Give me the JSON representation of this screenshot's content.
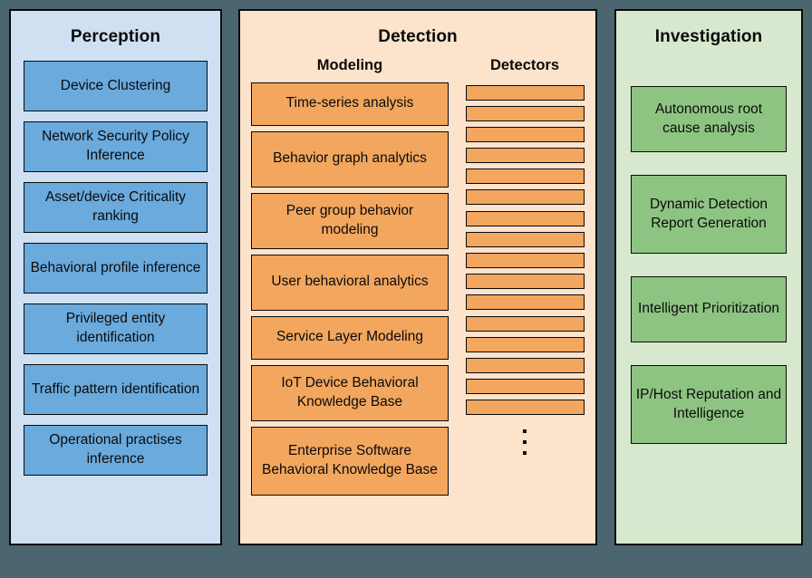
{
  "diagram": {
    "background_color": "#4c6670",
    "columns": [
      {
        "id": "perception",
        "title": "Perception",
        "panel_color": "#cfe0f2",
        "box_color": "#6aaadd",
        "items": [
          "Device Clustering",
          "Network Security Policy Inference",
          "Asset/device Criticality ranking",
          "Behavioral profile inference",
          "Privileged entity identification",
          "Traffic pattern identification",
          "Operational practises inference"
        ]
      },
      {
        "id": "detection",
        "title": "Detection",
        "panel_color": "#fce3cc",
        "box_color": "#f2a65e",
        "subsections": [
          {
            "id": "modeling",
            "title": "Modeling",
            "items": [
              "Time-series analysis",
              "Behavior graph analytics",
              "Peer group behavior modeling",
              "User behavioral analytics",
              "Service Layer Modeling",
              "IoT Device Behavioral Knowledge Base",
              "Enterprise Software Behavioral Knowledge Base"
            ]
          },
          {
            "id": "detectors",
            "title": "Detectors",
            "bar_count": 16,
            "ellipsis": "vertical-ellipsis"
          }
        ]
      },
      {
        "id": "investigation",
        "title": "Investigation",
        "panel_color": "#d8e8ce",
        "box_color": "#8ec482",
        "items": [
          "Autonomous root cause analysis",
          "Dynamic Detection Report Generation",
          "Intelligent Prioritization",
          "IP/Host Reputation and Intelligence"
        ]
      }
    ]
  }
}
